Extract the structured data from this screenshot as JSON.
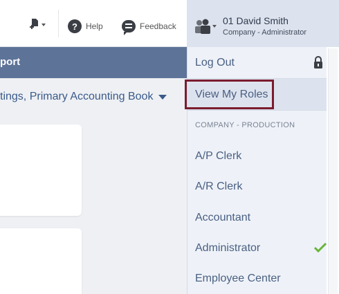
{
  "header": {
    "help_label": "Help",
    "feedback_label": "Feedback",
    "help_icon_glyph": "?",
    "user_name": "01 David Smith",
    "user_role": "Company - Administrator"
  },
  "page": {
    "title_fragment": "port",
    "subtitle_fragment": "tings, Primary Accounting Book"
  },
  "dropdown": {
    "logout_label": "Log Out",
    "view_roles_label": "View My Roles",
    "section_label": "COMPANY - PRODUCTION",
    "roles": [
      "A/P Clerk",
      "A/R Clerk",
      "Accountant",
      "Administrator",
      "Employee Center"
    ],
    "active_role": "Administrator"
  },
  "colors": {
    "accent_bar": "#5e7398",
    "highlight_outline": "#7a1c2e",
    "check_green": "#6ab43c"
  }
}
